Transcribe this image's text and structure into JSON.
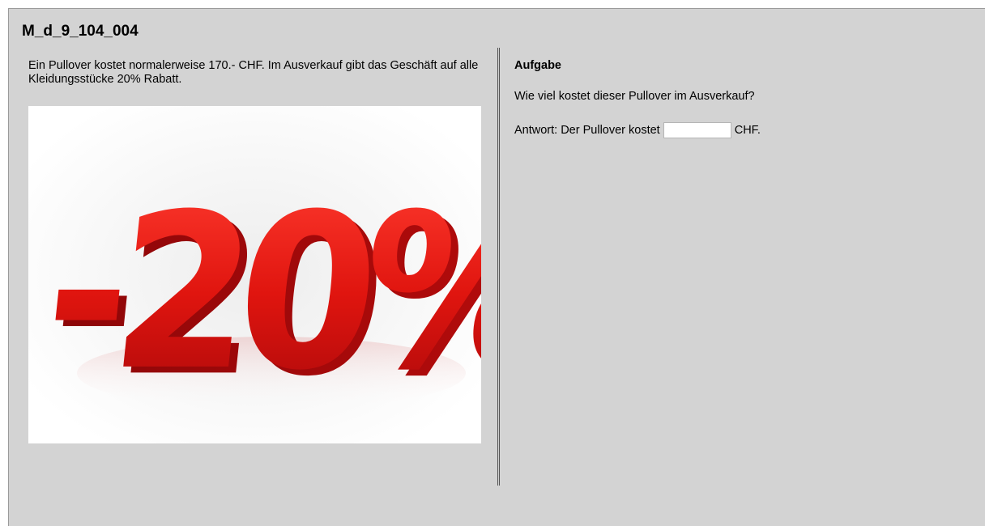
{
  "page": {
    "title": "M_d_9_104_004"
  },
  "left": {
    "intro_text": "Ein Pullover kostet normalerweise 170.- CHF. Im Ausverkauf gibt das Geschäft auf alle Kleidungsstücke 20% Rabatt.",
    "image": {
      "icon": "discount-20-percent-image",
      "text": "-20%",
      "color": "#d8120d"
    }
  },
  "right": {
    "heading": "Aufgabe",
    "question": "Wie viel kostet dieser Pullover im Ausverkauf?",
    "answer_prefix": "Antwort: Der Pullover kostet",
    "answer_value": "",
    "answer_placeholder": "",
    "answer_suffix": "CHF."
  }
}
